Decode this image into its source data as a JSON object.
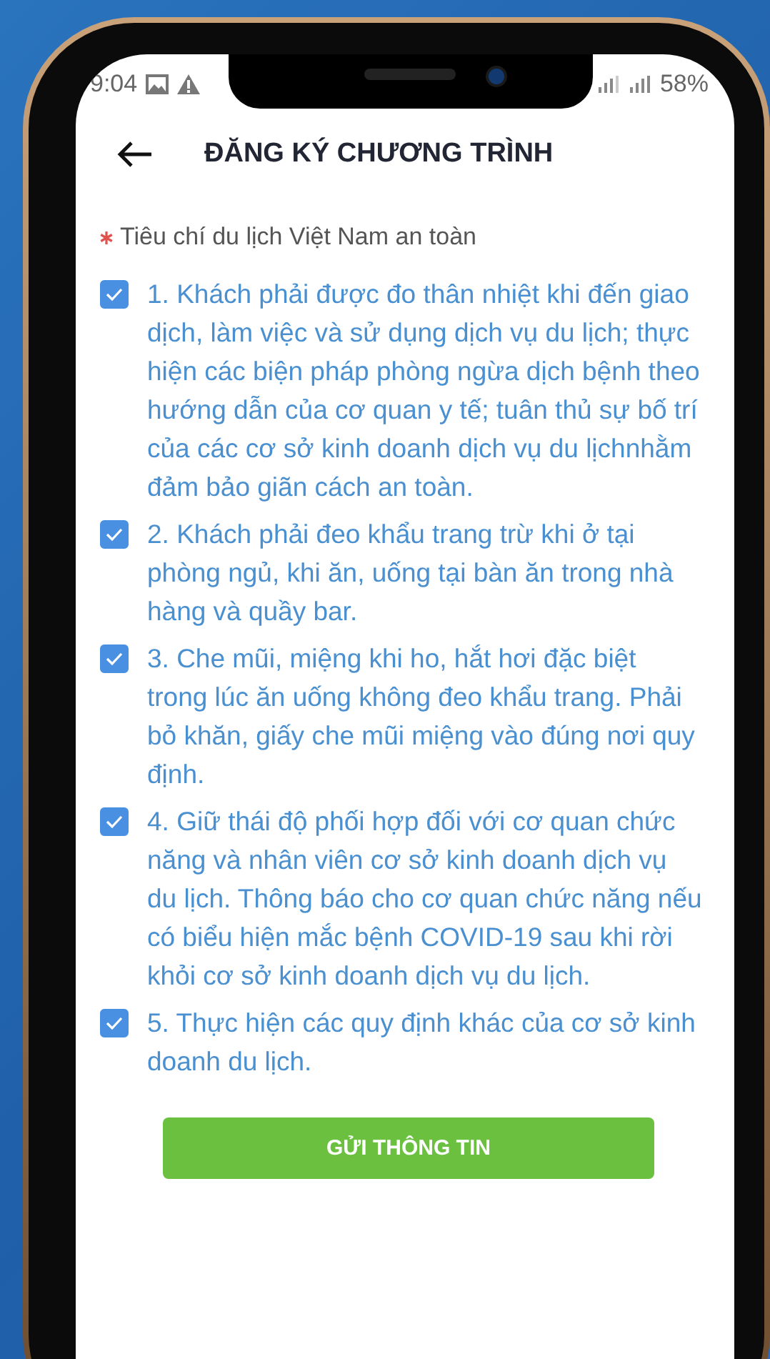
{
  "status_bar": {
    "time": "9:04",
    "battery": "58%"
  },
  "header": {
    "title": "ĐĂNG KÝ CHƯƠNG TRÌNH"
  },
  "field": {
    "label": "Tiêu chí du lịch Việt Nam an toàn",
    "required": true
  },
  "options": [
    {
      "text": "1. Khách phải được đo thân nhiệt khi đến giao dịch, làm việc và sử dụng dịch vụ du lịch; thực hiện các biện pháp phòng ngừa dịch bệnh theo hướng dẫn của cơ quan y tế; tuân thủ sự bố trí của các cơ sở kinh doanh dịch vụ du lịchnhằm đảm bảo giãn cách an toàn.",
      "checked": true
    },
    {
      "text": "2. Khách phải đeo khẩu trang trừ khi ở tại phòng ngủ, khi ăn, uống tại bàn ăn trong nhà hàng và quầy bar.",
      "checked": true
    },
    {
      "text": "3. Che mũi, miệng khi ho, hắt hơi đặc biệt trong lúc ăn uống không đeo khẩu trang. Phải bỏ khăn, giấy che mũi miệng vào đúng nơi quy định.",
      "checked": true
    },
    {
      "text": "4. Giữ thái độ phối hợp đối với cơ quan chức năng và nhân viên cơ sở kinh doanh dịch vụ du lịch. Thông báo cho cơ quan chức năng nếu có biểu hiện mắc bệnh COVID-19 sau khi rời khỏi cơ sở kinh doanh dịch vụ du lịch.",
      "checked": true
    },
    {
      "text": "5. Thực hiện các quy định khác của cơ sở kinh doanh du lịch.",
      "checked": true
    }
  ],
  "submit_button": {
    "label": "GỬI THÔNG TIN"
  }
}
